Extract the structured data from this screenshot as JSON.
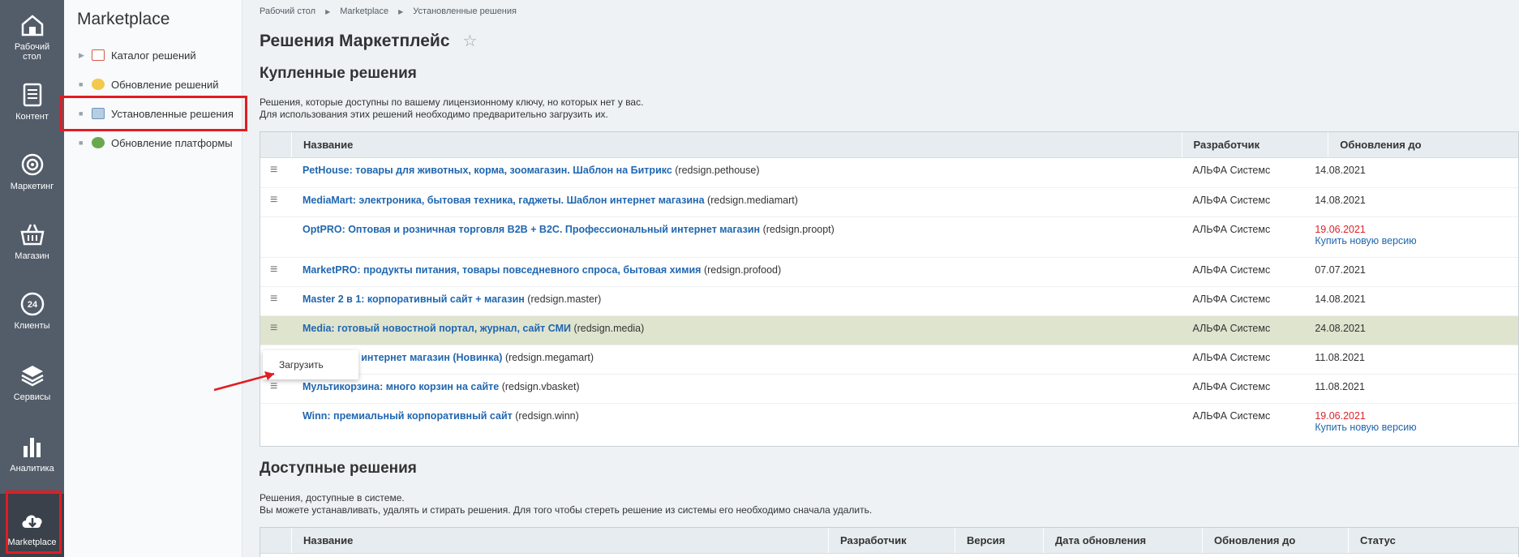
{
  "rail": [
    {
      "label1": "Рабочий",
      "label2": "стол",
      "icon": "home-icon"
    },
    {
      "label1": "Контент",
      "label2": "",
      "icon": "document-icon"
    },
    {
      "label1": "Маркетинг",
      "label2": "",
      "icon": "target-icon"
    },
    {
      "label1": "Магазин",
      "label2": "",
      "icon": "basket-icon"
    },
    {
      "label1": "Клиенты",
      "label2": "",
      "icon": "clients-24-icon",
      "badge": "24"
    },
    {
      "label1": "Сервисы",
      "label2": "",
      "icon": "layers-icon"
    },
    {
      "label1": "Аналитика",
      "label2": "",
      "icon": "bar-chart-icon"
    },
    {
      "label1": "Marketplace",
      "label2": "",
      "icon": "cloud-download-icon"
    }
  ],
  "sidebar": {
    "title": "Marketplace",
    "items": [
      {
        "label": "Каталог решений",
        "icon": "catalog-icon"
      },
      {
        "label": "Обновление решений",
        "icon": "update-icon"
      },
      {
        "label": "Установленные решения",
        "icon": "installed-icon"
      },
      {
        "label": "Обновление платформы",
        "icon": "platform-update-icon"
      }
    ]
  },
  "breadcrumbs": [
    "Рабочий стол",
    "Marketplace",
    "Установленные решения"
  ],
  "page_title": "Решения Маркетплейс",
  "bought": {
    "title": "Купленные решения",
    "desc1": "Решения, которые доступны по вашему лицензионному ключу, но которых нет у вас.",
    "desc2": "Для использования этих решений необходимо предварительно загрузить их.",
    "headers": [
      "Название",
      "Разработчик",
      "Обновления до"
    ],
    "rows": [
      {
        "name": "PetHouse: товары для животных, корма, зоомагазин. Шаблон на Битрикс",
        "code": " (redsign.pethouse)",
        "dev": "АЛЬФА Системс",
        "date": "14.08.2021",
        "extra": ""
      },
      {
        "name": "MediaMart: электроника, бытовая техника, гаджеты. Шаблон интернет магазина",
        "code": " (redsign.mediamart)",
        "dev": "АЛЬФА Системс",
        "date": "14.08.2021",
        "extra": ""
      },
      {
        "name": "OptPRO: Оптовая и розничная торговля B2B + B2C. Профессиональный интернет магазин",
        "code": " (redsign.proopt)",
        "dev": "АЛЬФА Системс",
        "date": "19.06.2021",
        "extra": "Купить новую версию"
      },
      {
        "name": "MarketPRO: продукты питания, товары повседневного спроса, бытовая химия",
        "code": " (redsign.profood)",
        "dev": "АЛЬФА Системс",
        "date": "07.07.2021",
        "extra": ""
      },
      {
        "name": "Master 2 в 1: корпоративный сайт + магазин",
        "code": " (redsign.master)",
        "dev": "АЛЬФА Системс",
        "date": "14.08.2021",
        "extra": ""
      },
      {
        "name": "Media: готовый новостной портал, журнал, сайт СМИ",
        "code": " (redsign.media)",
        "dev": "АЛЬФА Системс",
        "date": "24.08.2021",
        "extra": ""
      },
      {
        "name": "MegaMart – интернет магазин (Новинка)",
        "code": " (redsign.megamart)",
        "dev": "АЛЬФА Системс",
        "date": "11.08.2021",
        "extra": ""
      },
      {
        "name": "Мультикорзина: много корзин на сайте",
        "code": " (redsign.vbasket)",
        "dev": "АЛЬФА Системс",
        "date": "11.08.2021",
        "extra": ""
      },
      {
        "name": "Winn: премиальный корпоративный сайт",
        "code": " (redsign.winn)",
        "dev": "АЛЬФА Системс",
        "date": "19.06.2021",
        "extra": "Купить новую версию"
      }
    ]
  },
  "popup": {
    "label": "Загрузить"
  },
  "available": {
    "title": "Доступные решения",
    "desc1": "Решения, доступные в системе.",
    "desc2": "Вы можете устанавливать, удалять и стирать решения. Для того чтобы стереть решение из системы его необходимо сначала удалить.",
    "headers": [
      "Название",
      "Разработчик",
      "Версия",
      "Дата обновления",
      "Обновления до",
      "Статус"
    ]
  },
  "colors": {
    "rail": "#535c69",
    "link": "#2067b0",
    "expired": "#d9242b",
    "highlight": "#dfe4cf",
    "annotation": "#e21c23"
  }
}
